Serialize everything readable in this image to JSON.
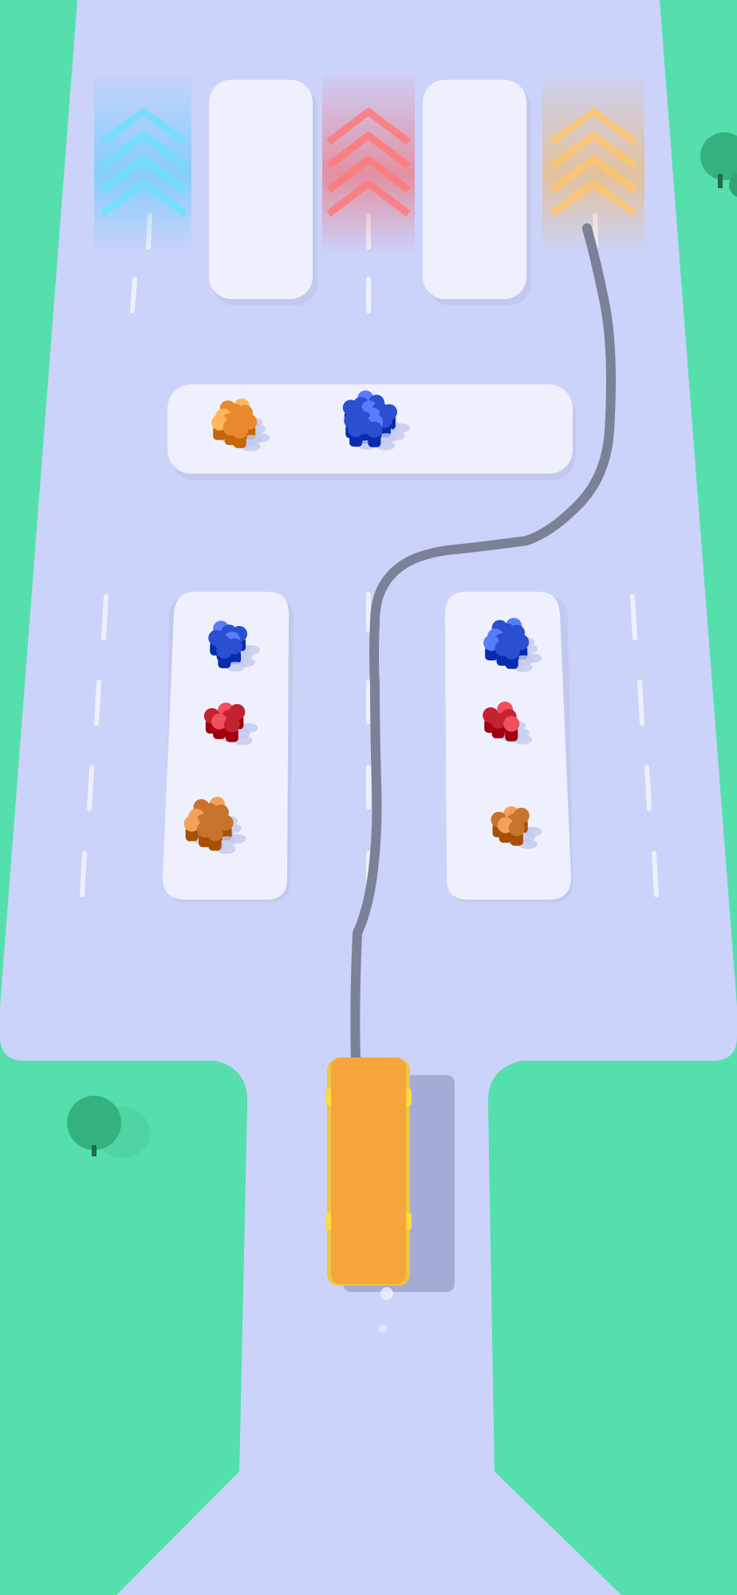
{
  "game": {
    "type": "draw-path bus sorting",
    "colors": {
      "grass": "#55dfac",
      "grass_edge": "#3fcf98",
      "road": "#cbd3fb",
      "road_dark": "#bfc7f2",
      "platform": "#eef1fd",
      "platform_shadow": "#c3c9ee",
      "lane_dash": "#f2f4ff",
      "bus": "#f6a53a",
      "bus_side": "#f2c43a",
      "bus_shadow": "#a3abd6",
      "path_line": "#7b8196",
      "tree": "#33b27d"
    },
    "exits": [
      {
        "color_name": "blue",
        "color": "#4ec9f7"
      },
      {
        "color_name": "red",
        "color": "#f45a5a"
      },
      {
        "color_name": "orange",
        "color": "#f5b24f"
      }
    ],
    "barriers": 2,
    "crowds": [
      {
        "platform": "top",
        "color_name": "orange",
        "color": "#e8892f",
        "count": 12
      },
      {
        "platform": "top",
        "color_name": "blue",
        "color": "#2b4fd1",
        "count": 16
      },
      {
        "platform": "left",
        "color_name": "blue",
        "color": "#2b4fd1",
        "count": 8
      },
      {
        "platform": "left",
        "color_name": "red",
        "color": "#c42131",
        "count": 6
      },
      {
        "platform": "left",
        "color_name": "orange",
        "color": "#c8732c",
        "count": 12
      },
      {
        "platform": "right",
        "color_name": "blue",
        "color": "#2b4fd1",
        "count": 12
      },
      {
        "platform": "right",
        "color_name": "red",
        "color": "#c42131",
        "count": 5
      },
      {
        "platform": "right",
        "color_name": "orange",
        "color": "#c8732c",
        "count": 6
      }
    ],
    "bus": {
      "color_name": "orange"
    },
    "drawn_path_target": "orange exit",
    "trees": 2
  }
}
